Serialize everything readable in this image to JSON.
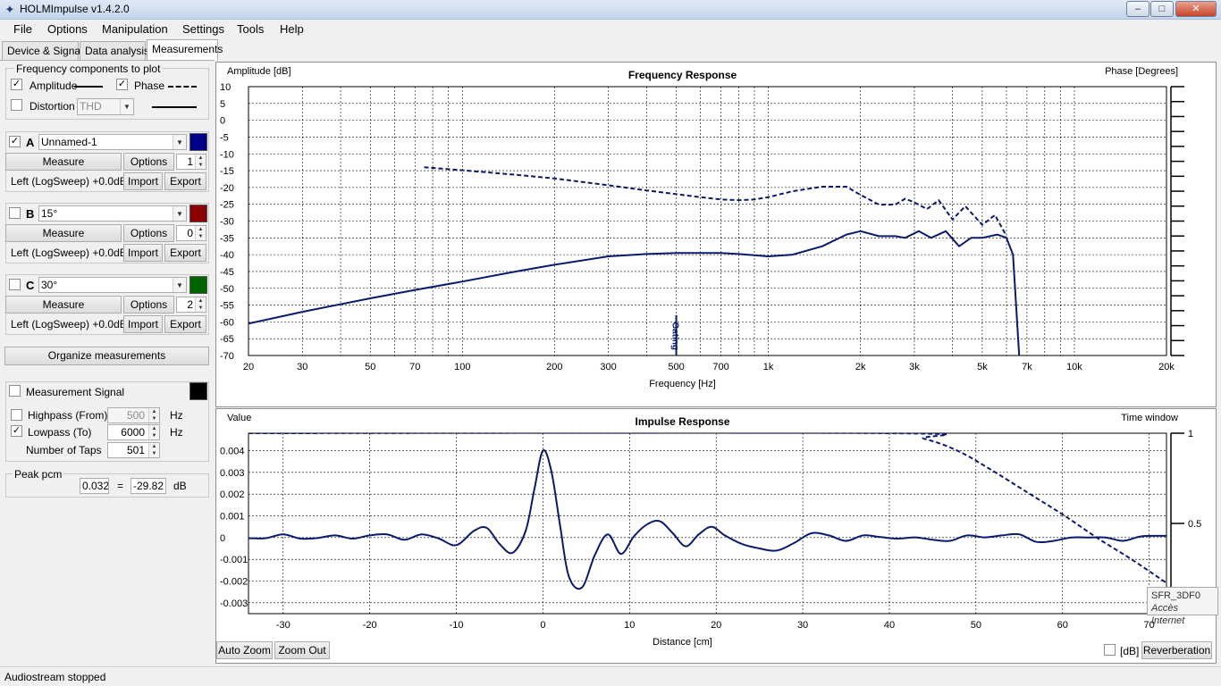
{
  "window": {
    "title": "HOLMImpulse  v1.4.2.0",
    "minimize_glyph": "–",
    "maximize_glyph": "□",
    "close_glyph": "✕"
  },
  "menu": [
    "File",
    "Options",
    "Manipulation",
    "Settings",
    "Tools",
    "Help"
  ],
  "tabs": [
    "Device & Signal",
    "Data analysis",
    "Measurements"
  ],
  "freq_components": {
    "title": "Frequency components to plot",
    "amplitude_label": "Amplitude",
    "amplitude_checked": true,
    "phase_label": "Phase",
    "phase_checked": true,
    "distortion_label": "Distortion",
    "distortion_checked": false,
    "distortion_select": "THD"
  },
  "channels": [
    {
      "letter": "A",
      "checked": true,
      "name": "Unnamed-1",
      "color": "#00008b",
      "measure": "Measure",
      "options": "Options",
      "taps": "1",
      "source": "Left (LogSweep) +0.0dB",
      "import": "Import",
      "export": "Export"
    },
    {
      "letter": "B",
      "checked": false,
      "name": "15°",
      "color": "#8b0000",
      "measure": "Measure",
      "options": "Options",
      "taps": "0",
      "source": "Left (LogSweep) +0.0dB",
      "import": "Import",
      "export": "Export"
    },
    {
      "letter": "C",
      "checked": false,
      "name": "30°",
      "color": "#006400",
      "measure": "Measure",
      "options": "Options",
      "taps": "2",
      "source": "Left (LogSweep) +0.0dB",
      "import": "Import",
      "export": "Export"
    }
  ],
  "organize_button": "Organize measurements",
  "measurement_signal": {
    "label": "Measurement Signal",
    "checked": false,
    "color": "#000000",
    "highpass_label": "Highpass (From)",
    "highpass_checked": false,
    "highpass_value": "500",
    "highpass_unit": "Hz",
    "lowpass_label": "Lowpass (To)",
    "lowpass_checked": true,
    "lowpass_value": "6000",
    "lowpass_unit": "Hz",
    "taps_label": "Number of Taps",
    "taps_value": "501"
  },
  "peak": {
    "title": "Peak pcm",
    "value": "0.032",
    "equals": "=",
    "db_value": "-29.82",
    "unit": "dB"
  },
  "collapse_arrow": "▲",
  "freq_plot": {
    "title": "Frequency Response",
    "left_label": "Amplitude [dB]",
    "right_label": "Phase [Degrees]",
    "xlabel": "Frequency [Hz]",
    "marker_label": "Gating"
  },
  "impulse_plot": {
    "title": "Impulse Response",
    "left_label": "Value",
    "right_label": "Time window",
    "xlabel": "Distance [cm]",
    "auto_zoom": "Auto Zoom",
    "zoom_out": "Zoom Out",
    "db_label": "[dB]",
    "db_checked": false,
    "reverberation": "Reverberation"
  },
  "tooltip": {
    "line1": "SFR_3DF0",
    "line2": "Accès Internet"
  },
  "status": "Audiostream stopped",
  "chart_data": [
    {
      "type": "line",
      "title": "Frequency Response",
      "xlabel": "Frequency [Hz]",
      "ylabel": "Amplitude [dB]",
      "y2label": "Phase [Degrees]",
      "xscale": "log",
      "xlim": [
        20,
        20000
      ],
      "ylim": [
        -70,
        10
      ],
      "y2lim": [
        -180,
        180
      ],
      "grid": true,
      "x_ticks": [
        20,
        30,
        50,
        70,
        100,
        200,
        300,
        500,
        700,
        1000,
        2000,
        3000,
        5000,
        7000,
        10000,
        20000
      ],
      "x_tick_labels": [
        "20",
        "30",
        "50",
        "70",
        "100",
        "200",
        "300",
        "500",
        "700",
        "1k",
        "2k",
        "3k",
        "5k",
        "7k",
        "10k",
        "20k"
      ],
      "y_ticks": [
        10,
        5,
        0,
        -5,
        -10,
        -15,
        -20,
        -25,
        -30,
        -35,
        -40,
        -45,
        -50,
        -55,
        -60,
        -65,
        -70
      ],
      "y2_ticks": [
        180,
        160,
        140,
        120,
        100,
        80,
        60,
        40,
        20,
        0,
        -20,
        -40,
        -60,
        -80,
        -100,
        -120,
        -140,
        -160,
        -180
      ],
      "marker_x": 500,
      "series": [
        {
          "style": "solid",
          "axis": "left",
          "color": "#0a1a6e",
          "x": [
            20,
            30,
            50,
            70,
            100,
            150,
            200,
            300,
            400,
            500,
            700,
            800,
            1000,
            1200,
            1500,
            1800,
            2000,
            2300,
            2600,
            2800,
            3100,
            3400,
            3800,
            4200,
            4600,
            5000,
            5600,
            6000,
            6300,
            6600
          ],
          "y": [
            -60.5,
            -57,
            -53,
            -50.5,
            -48,
            -45,
            -43,
            -40.5,
            -39.8,
            -39.5,
            -39.5,
            -39.8,
            -40.5,
            -40,
            -37.5,
            -34,
            -33,
            -34.5,
            -34.5,
            -35,
            -33,
            -35,
            -33,
            -37.5,
            -35,
            -35,
            -34,
            -35,
            -40,
            -70
          ]
        },
        {
          "style": "dashed",
          "axis": "right",
          "color": "#0a1a6e",
          "x": [
            75,
            100,
            150,
            200,
            300,
            400,
            500,
            600,
            700,
            800,
            900,
            1000,
            1200,
            1500,
            1800,
            2000,
            2300,
            2600,
            2800,
            3000,
            3300,
            3600,
            4000,
            4400,
            5000,
            5500,
            6000
          ],
          "y": [
            72,
            68,
            62,
            57,
            48,
            41,
            36,
            32,
            29,
            28,
            29,
            32,
            40,
            46,
            46,
            35,
            22,
            22,
            30,
            25,
            16,
            28,
            2,
            20,
            -5,
            8,
            -20
          ]
        }
      ]
    },
    {
      "type": "line",
      "title": "Impulse Response",
      "xlabel": "Distance [cm]",
      "ylabel": "Value",
      "y2label": "Time window",
      "xlim": [
        -34,
        72
      ],
      "ylim": [
        -0.0035,
        0.0048
      ],
      "y2lim": [
        0,
        1
      ],
      "grid": true,
      "x_ticks": [
        -30,
        -20,
        -10,
        0,
        10,
        20,
        30,
        40,
        50,
        60,
        70
      ],
      "y_ticks": [
        0.004,
        0.003,
        0.002,
        0.001,
        0,
        -0.001,
        -0.002,
        -0.003
      ],
      "y_tick_labels": [
        "0.004",
        "0.003",
        "0.002",
        "0.001",
        "0",
        "-0.001",
        "-0.002",
        "-0.003"
      ],
      "y2_ticks": [
        1,
        0.5
      ],
      "series": [
        {
          "style": "solid",
          "axis": "left",
          "color": "#0a1a6e",
          "x": [
            -34,
            -32,
            -30,
            -28,
            -26,
            -24,
            -22,
            -20,
            -18,
            -16,
            -14,
            -12,
            -10,
            -8,
            -6.5,
            -5,
            -3.5,
            -2,
            -1,
            0,
            1,
            2,
            3,
            4.5,
            6,
            7.5,
            9,
            10.5,
            12,
            13.5,
            15,
            16.5,
            18,
            19.5,
            21,
            23,
            25,
            27,
            29,
            31,
            33,
            35,
            37,
            39,
            41,
            43,
            45,
            47,
            49,
            51,
            53,
            55,
            57,
            59,
            61,
            63,
            65,
            67,
            69,
            71,
            72
          ],
          "y": [
            -3e-05,
            -3e-05,
            0.00015,
            -5e-05,
            -2e-05,
            0.0001,
            -5e-05,
            0.0001,
            0.00015,
            -0.0001,
            0.00015,
            -5e-05,
            -0.00035,
            0.0003,
            0.00045,
            -0.0003,
            -0.0007,
            0.0003,
            0.0022,
            0.004,
            0.003,
            0.0005,
            -0.0018,
            -0.0023,
            -0.0008,
            0.00015,
            -0.00075,
            5e-05,
            0.0006,
            0.00075,
            0.0002,
            -0.0004,
            0.00015,
            0.0005,
            0.0001,
            -0.0003,
            -0.0005,
            -0.0006,
            -0.00025,
            0.0002,
            0.0001,
            -0.00015,
            0.0001,
            2e-05,
            -5e-05,
            1e-05,
            -0.0001,
            -0.00015,
            0.0001,
            1e-05,
            0.0001,
            0.00015,
            -0.0002,
            -0.00015,
            0,
            0,
            0,
            -0.00015,
            5e-05,
            8e-05,
            8e-05
          ]
        },
        {
          "style": "dashed",
          "axis": "right",
          "color": "#0a1a6e",
          "x": [
            -34,
            40,
            44,
            48,
            52,
            56,
            60,
            64,
            68,
            72
          ],
          "y": [
            1,
            1,
            0.97,
            0.9,
            0.79,
            0.67,
            0.55,
            0.42,
            0.3,
            0.17
          ]
        }
      ]
    }
  ]
}
